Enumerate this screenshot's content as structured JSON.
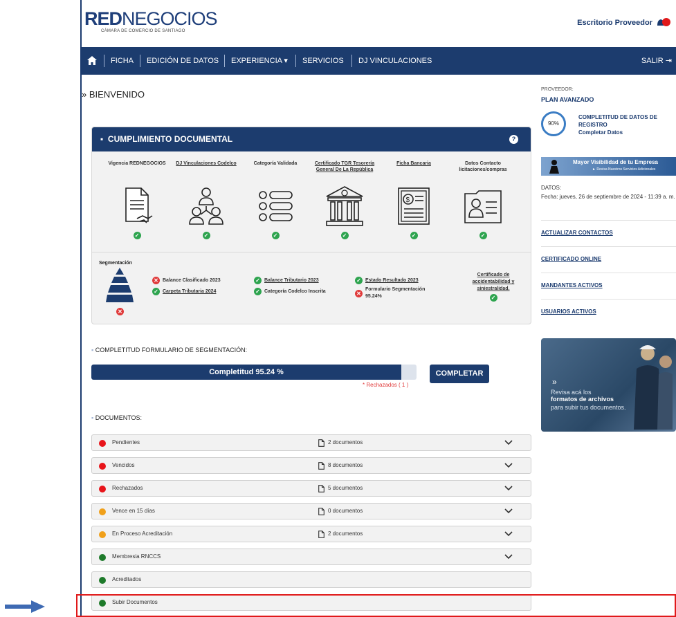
{
  "header": {
    "logo_bold": "RED",
    "logo_rest": "NEGOCIOS",
    "logo_sub": "CÁMARA DE COMERCIO DE SANTIAGO",
    "escritorio": "Escritorio Proveedor"
  },
  "nav": {
    "items": [
      "FICHA",
      "EDICIÓN DE DATOS",
      "EXPERIENCIA ▾",
      "SERVICIOS",
      "DJ VINCULACIONES"
    ],
    "salir": "SALIR"
  },
  "welcome": "BIENVENIDO",
  "cumplimiento": {
    "title": "CUMPLIMIENTO DOCUMENTAL",
    "docs": [
      {
        "label": "Vigencia REDNEGOCIOS",
        "icon": "contract-handshake-icon",
        "status": "ok"
      },
      {
        "label": "DJ Vinculaciones Codelco",
        "icon": "people-network-icon",
        "status": "ok"
      },
      {
        "label": "Categoría Validada",
        "icon": "list-icon",
        "status": "ok"
      },
      {
        "label": "Certificado TGR Tesorería General De La República",
        "icon": "bank-icon",
        "status": "ok"
      },
      {
        "label": "Ficha Bancaria",
        "icon": "bank-document-icon",
        "status": "ok"
      },
      {
        "label": "Datos Contacto licitaciones/compras",
        "icon": "contact-card-icon",
        "status": "ok"
      }
    ],
    "segmentacion_title": "Segmentación",
    "seg_items": [
      {
        "label": "Balance Clasificado 2023",
        "status": "error"
      },
      {
        "label": "Carpeta Tributaria 2024",
        "status": "ok"
      },
      {
        "label": "Balance Tributario 2023",
        "status": "ok"
      },
      {
        "label": "Categoría Codelco Inscrita",
        "status": "ok"
      },
      {
        "label": "Estado Resultado 2023",
        "status": "ok"
      },
      {
        "label": "Formulario Segmentación 95.24%",
        "status": "error"
      },
      {
        "label": "Certificado de accidentabilidad y siniestralidad.",
        "status": "ok"
      }
    ]
  },
  "completitud": {
    "title": "COMPLETITUD FORMULARIO DE SEGMENTACIÓN:",
    "bar_text": "Completitud 95.24 %",
    "percent": 95.24,
    "rechazados": "* Rechazados ( 1 )",
    "button": "COMPLETAR"
  },
  "documentos": {
    "title": "DOCUMENTOS:",
    "rows": [
      {
        "label": "Pendientes",
        "color": "#e8141a",
        "count": "2 documentos",
        "expandable": true
      },
      {
        "label": "Vencidos",
        "color": "#e8141a",
        "count": "8 documentos",
        "expandable": true
      },
      {
        "label": "Rechazados",
        "color": "#e8141a",
        "count": "5 documentos",
        "expandable": true
      },
      {
        "label": "Vence en 15 días",
        "color": "#f0a01a",
        "count": "0 documentos",
        "expandable": true
      },
      {
        "label": "En Proceso Acreditación",
        "color": "#f0a01a",
        "count": "2 documentos",
        "expandable": true
      },
      {
        "label": "Membresia RNCCS",
        "color": "#1e7a2a",
        "count": "",
        "expandable": true
      },
      {
        "label": "Acreditados",
        "color": "#1e7a2a",
        "count": "",
        "expandable": false
      },
      {
        "label": "Subir Documentos",
        "color": "#1e7a2a",
        "count": "",
        "expandable": false
      }
    ]
  },
  "sidebar": {
    "proveedor": "PROVEEDOR:",
    "plan": "PLAN AVANZADO",
    "gauge": "90%",
    "gauge_value": 90,
    "completitud_line1": "COMPLETITUD DE DATOS DE",
    "completitud_line2": "REGISTRO",
    "completar_datos": "Completar Datos",
    "banner_t1": "Mayor Visibilidad de tu Empresa",
    "banner_t2": "► Revisa Nuestros Servicios Adicionales",
    "datos_title": "DATOS:",
    "fecha": "Fecha: jueves, 26 de septiembre de 2024 - 11:39 a. m.",
    "links": [
      "ACTUALIZAR CONTACTOS",
      "CERTIFICADO ONLINE",
      "MANDANTES ACTIVOS",
      "USUARIOS ACTIVOS"
    ],
    "promo_t1": "Revisa acá los",
    "promo_t2": "formatos de archivos",
    "promo_t3": "para subir tus documentos."
  },
  "colors": {
    "primary": "#1c3c6e",
    "ok": "#2ea44f",
    "error": "#e03b3b",
    "highlight": "#e0191a"
  }
}
